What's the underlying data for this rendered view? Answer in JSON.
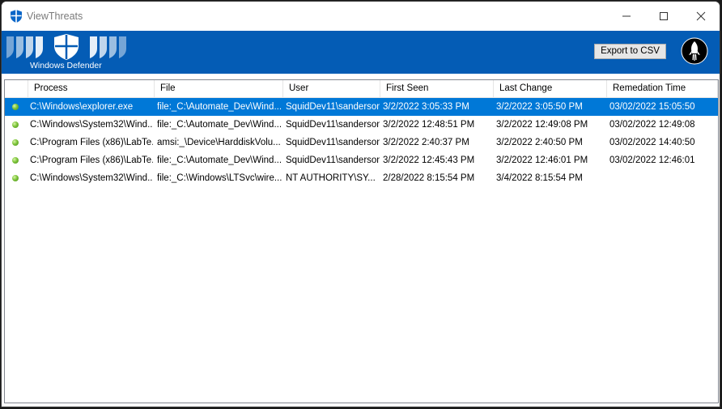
{
  "window": {
    "title": "ViewThreats"
  },
  "banner": {
    "caption": "Windows Defender",
    "export_label": "Export to CSV",
    "colors": {
      "banner": "#045cb5",
      "selection": "#0078d7",
      "status_ok": "#7dc43a"
    }
  },
  "icons": {
    "app": "shield-icon",
    "logo": "defender-shields-icon",
    "rocket": "rocket-icon",
    "status": "green-status-dot-icon"
  },
  "table": {
    "columns": [
      "Process",
      "File",
      "User",
      "First Seen",
      "Last Change",
      "Remedation Time"
    ],
    "rows": [
      {
        "status": "ok",
        "process": "C:\\Windows\\explorer.exe",
        "file": "file:_C:\\Automate_Dev\\Wind...",
        "user": "SquidDev11\\sanderson",
        "first_seen": "3/2/2022 3:05:33 PM",
        "last_change": "3/2/2022 3:05:50 PM",
        "remediation": "03/02/2022 15:05:50",
        "selected": true
      },
      {
        "status": "ok",
        "process": "C:\\Windows\\System32\\Wind...",
        "file": "file:_C:\\Automate_Dev\\Wind...",
        "user": "SquidDev11\\sanderson",
        "first_seen": "3/2/2022 12:48:51 PM",
        "last_change": "3/2/2022 12:49:08 PM",
        "remediation": "03/02/2022 12:49:08",
        "selected": false
      },
      {
        "status": "ok",
        "process": "C:\\Program Files (x86)\\LabTe...",
        "file": "amsi:_\\Device\\HarddiskVolu...",
        "user": "SquidDev11\\sanderson",
        "first_seen": "3/2/2022 2:40:37 PM",
        "last_change": "3/2/2022 2:40:50 PM",
        "remediation": "03/02/2022 14:40:50",
        "selected": false
      },
      {
        "status": "ok",
        "process": "C:\\Program Files (x86)\\LabTe...",
        "file": "file:_C:\\Automate_Dev\\Wind...",
        "user": "SquidDev11\\sanderson",
        "first_seen": "3/2/2022 12:45:43 PM",
        "last_change": "3/2/2022 12:46:01 PM",
        "remediation": "03/02/2022 12:46:01",
        "selected": false
      },
      {
        "status": "ok",
        "process": "C:\\Windows\\System32\\Wind...",
        "file": "file:_C:\\Windows\\LTSvc\\wire...",
        "user": "NT AUTHORITY\\SY...",
        "first_seen": "2/28/2022 8:15:54 PM",
        "last_change": "3/4/2022 8:15:54 PM",
        "remediation": "",
        "selected": false
      }
    ]
  }
}
